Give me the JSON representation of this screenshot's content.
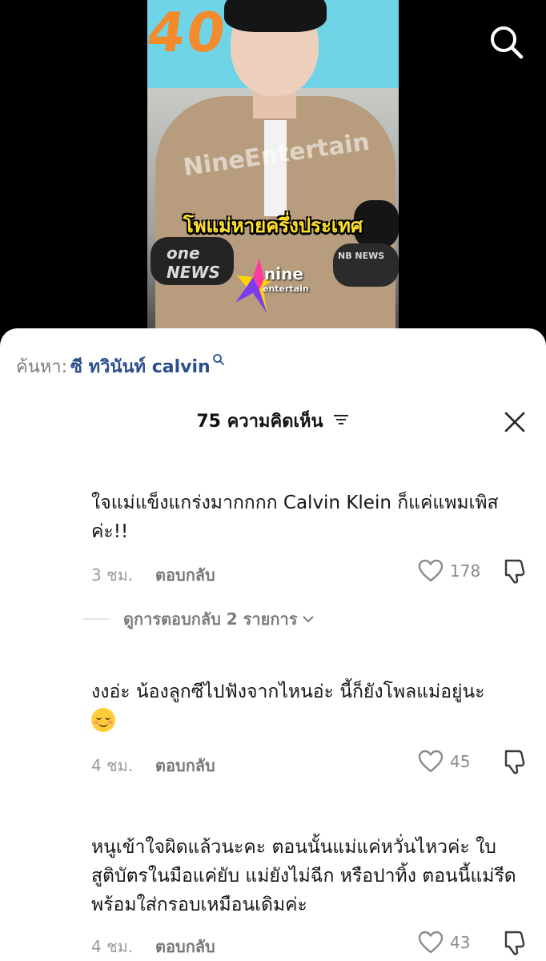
{
  "video": {
    "sign_text": "40",
    "watermark": "NineEntertain",
    "caption": "โพแม่หายครึ่งประเทศ",
    "mic_labels": {
      "one_news": "one NEWS",
      "nb_news": "NB NEWS"
    },
    "logo": {
      "nine": "nine",
      "entertain": "entertain"
    }
  },
  "search_suggestion": {
    "prefix": "ค้นหา:",
    "query": "ซี ทวินันท์ calvin"
  },
  "header": {
    "comments_count": "75 ความคิดเห็น"
  },
  "comments": [
    {
      "text": "ใจแม่แข็งแกร่งมากกกก Calvin Klein ก็แค่แพมเพิสค่ะ!!",
      "time": "3 ชม.",
      "reply_label": "ตอบกลับ",
      "likes": "178"
    },
    {
      "text": "งงอ่ะ น้องลูกซีไปฟังจากไหนอ่ะ นี้ก็ยังโพลแม่อยู่นะ",
      "emoji": "relieved-face",
      "time": "4 ชม.",
      "reply_label": "ตอบกลับ",
      "likes": "45"
    },
    {
      "text": "หนูเข้าใจผิดแล้วนะคะ ตอนนั้นแม่แค่หวั่นไหวค่ะ ใบสูติบัตรในมือแค่ยับ แม่ยังไม่ฉีก หรือปาทิ้ง ตอนนี้แม่รีดพร้อมใส่กรอบเหมือนเดิมค่ะ",
      "time": "4 ชม.",
      "reply_label": "ตอบกลับ",
      "likes": "43"
    }
  ],
  "view_replies": {
    "label": "ดูการตอบกลับ 2 รายการ"
  },
  "colors": {
    "sheet_bg": "#ffffff",
    "query_blue": "#2b4f8d",
    "caption_yellow": "#ffe02a",
    "sign_cyan": "#6fd4e8",
    "sign_orange": "#f38a2c"
  },
  "icons": {
    "search": "search-icon",
    "sort": "sort-icon",
    "close": "close-icon",
    "like": "heart-outline-icon",
    "dislike": "thumbs-down-icon",
    "chevron": "chevron-down-icon"
  }
}
